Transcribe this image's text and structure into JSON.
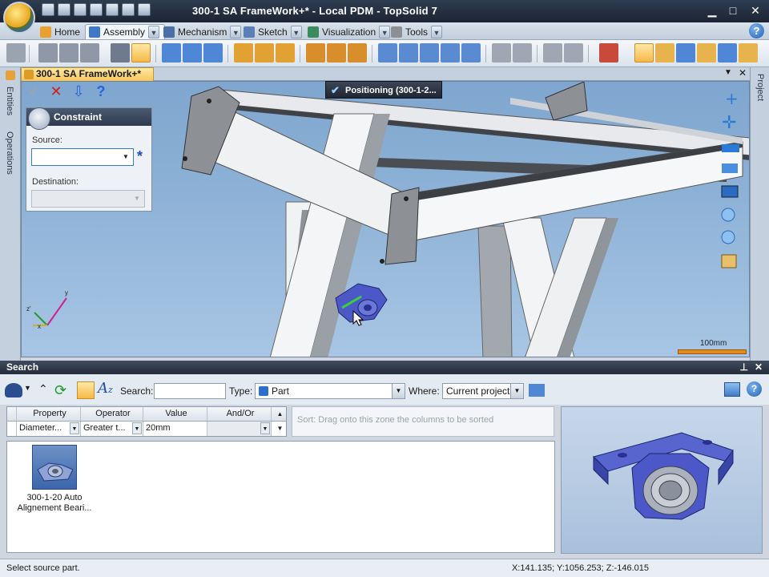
{
  "window": {
    "title": "300-1 SA FrameWork+* - Local PDM - TopSolid 7",
    "minimize": "▁",
    "maximize": "□",
    "close": "✕"
  },
  "tabs": [
    {
      "label": "Home"
    },
    {
      "label": "Assembly"
    },
    {
      "label": "Mechanism"
    },
    {
      "label": "Sketch"
    },
    {
      "label": "Visualization"
    },
    {
      "label": "Tools"
    }
  ],
  "help": "?",
  "document": {
    "tab_label": "300-1 SA FrameWork+*",
    "left_rail": [
      "Entities",
      "Operations"
    ],
    "right_rail": [
      "Project"
    ]
  },
  "viewport": {
    "positioning_label": "Positioning (300-1-2...",
    "scale_label": "100mm",
    "axis_labels": [
      "y",
      "z'",
      "x"
    ]
  },
  "constraint_panel": {
    "title": "Constraint",
    "source_label": "Source:",
    "source_value": "",
    "destination_label": "Destination:",
    "destination_value": "",
    "required_marker": "*"
  },
  "search": {
    "title": "Search",
    "search_label": "Search:",
    "search_value": "",
    "type_label": "Type:",
    "type_value": "Part",
    "where_label": "Where:",
    "where_value": "Current project",
    "criteria": {
      "headers": [
        "Property",
        "Operator",
        "Value",
        "And/Or"
      ],
      "row": [
        "Diameter...",
        "Greater t...",
        "20mm",
        ""
      ]
    },
    "sort_hint": "Sort: Drag onto this zone the columns to be sorted",
    "results": [
      {
        "label": "300-1-20 Auto Alignement Beari..."
      }
    ]
  },
  "status": {
    "message": "Select source part.",
    "coords": "X:141.135; Y:1056.253; Z:-146.015"
  },
  "colors": {
    "accent_orange": "#f6b848",
    "bearing_blue": "#4c58c8"
  }
}
